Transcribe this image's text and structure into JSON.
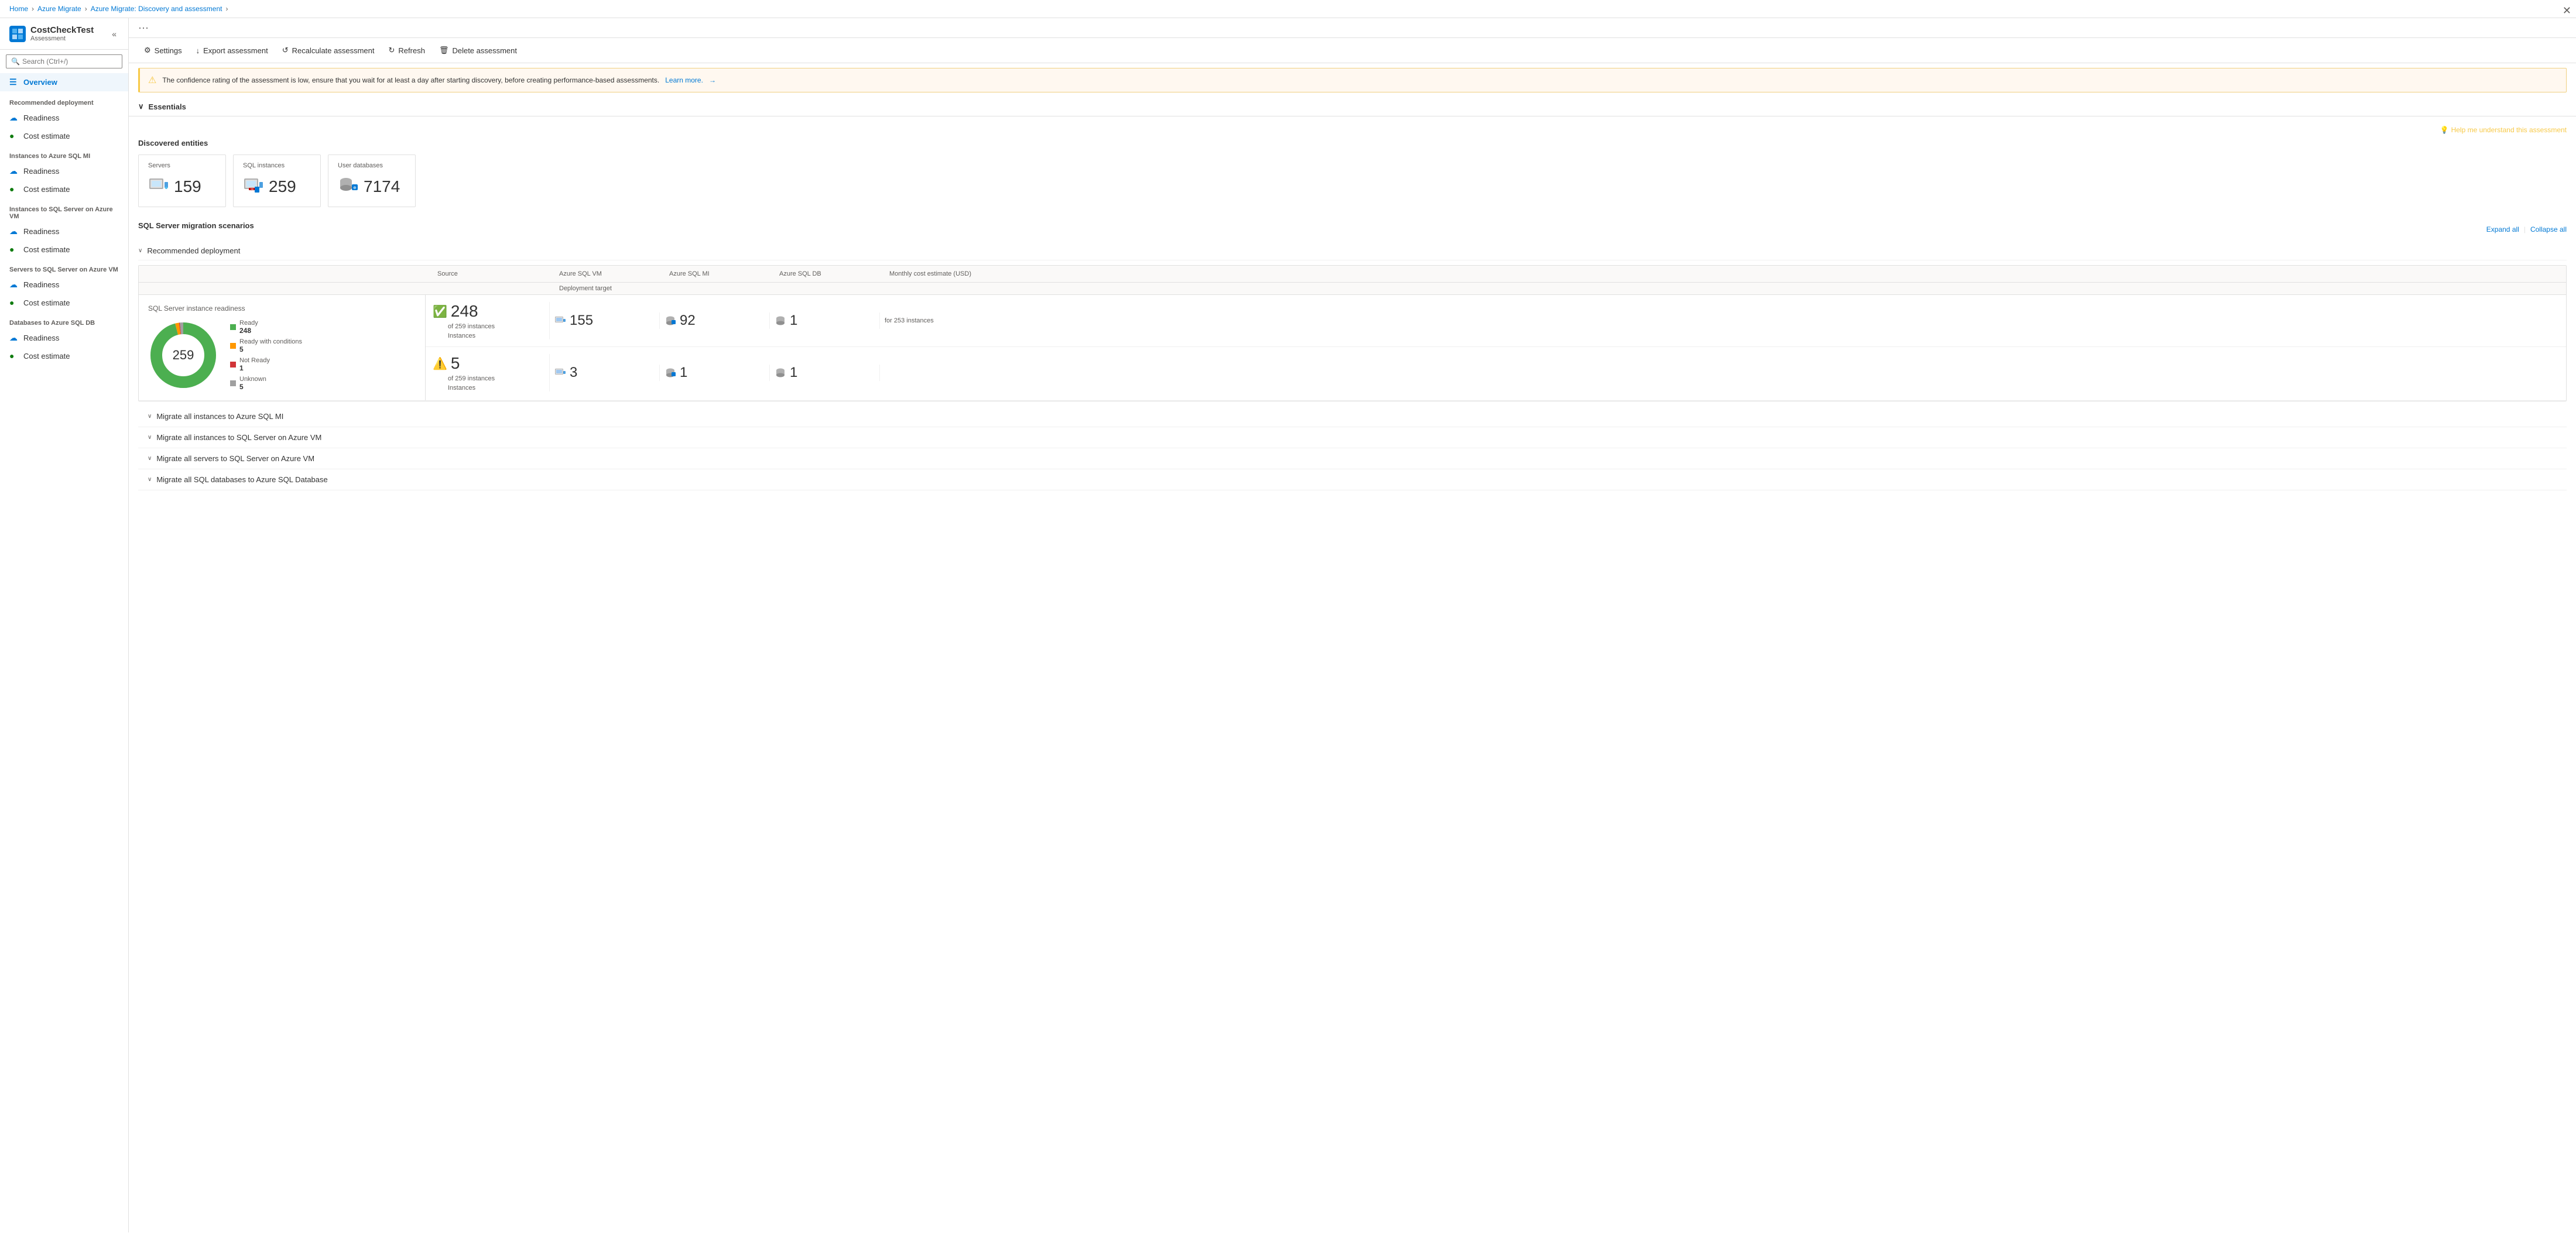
{
  "breadcrumb": {
    "home": "Home",
    "azure_migrate": "Azure Migrate",
    "discovery_assessment": "Azure Migrate: Discovery and assessment",
    "separator": "›"
  },
  "sidebar": {
    "app_icon": "🔷",
    "app_title": "CostCheckTest",
    "app_subtitle": "Assessment",
    "search_placeholder": "Search (Ctrl+/)",
    "nav_items": [
      {
        "id": "overview",
        "label": "Overview",
        "icon": "☰",
        "active": true,
        "section": null
      },
      {
        "id": "rec-deployment-header",
        "label": "Recommended deployment",
        "section": true
      },
      {
        "id": "readiness1",
        "label": "Readiness",
        "icon": "☁",
        "icon_color": "blue",
        "active": false,
        "section": null
      },
      {
        "id": "cost1",
        "label": "Cost estimate",
        "icon": "🟢",
        "icon_color": "green",
        "active": false,
        "section": null
      },
      {
        "id": "sql-mi-header",
        "label": "Instances to Azure SQL MI",
        "section": true
      },
      {
        "id": "readiness2",
        "label": "Readiness",
        "icon": "☁",
        "icon_color": "blue",
        "active": false,
        "section": null
      },
      {
        "id": "cost2",
        "label": "Cost estimate",
        "icon": "🟢",
        "icon_color": "green",
        "active": false,
        "section": null
      },
      {
        "id": "sql-vm-header",
        "label": "Instances to SQL Server on Azure VM",
        "section": true
      },
      {
        "id": "readiness3",
        "label": "Readiness",
        "icon": "☁",
        "icon_color": "blue",
        "active": false,
        "section": null
      },
      {
        "id": "cost3",
        "label": "Cost estimate",
        "icon": "🟢",
        "icon_color": "green",
        "active": false,
        "section": null
      },
      {
        "id": "servers-sql-vm-header",
        "label": "Servers to SQL Server on Azure VM",
        "section": true
      },
      {
        "id": "readiness4",
        "label": "Readiness",
        "icon": "☁",
        "icon_color": "blue",
        "active": false,
        "section": null
      },
      {
        "id": "cost4",
        "label": "Cost estimate",
        "icon": "🟢",
        "icon_color": "green",
        "active": false,
        "section": null
      },
      {
        "id": "db-sql-header",
        "label": "Databases to Azure SQL DB",
        "section": true
      },
      {
        "id": "readiness5",
        "label": "Readiness",
        "icon": "☁",
        "icon_color": "blue",
        "active": false,
        "section": null
      },
      {
        "id": "cost5",
        "label": "Cost estimate",
        "icon": "🟢",
        "icon_color": "green",
        "active": false,
        "section": null
      }
    ]
  },
  "toolbar": {
    "settings_label": "Settings",
    "export_label": "Export assessment",
    "recalculate_label": "Recalculate assessment",
    "refresh_label": "Refresh",
    "delete_label": "Delete assessment"
  },
  "warning": {
    "text": "The confidence rating of the assessment is low, ensure that you wait for at least a day after starting discovery, before creating performance-based assessments. Learn more.",
    "learn_more": "Learn more.",
    "arrow": "→"
  },
  "essentials": {
    "label": "Essentials",
    "chevron": "∨"
  },
  "help_link": "Help me understand this assessment",
  "discovered_entities": {
    "title": "Discovered entities",
    "servers": {
      "label": "Servers",
      "value": "159"
    },
    "sql_instances": {
      "label": "SQL instances",
      "value": "259"
    },
    "user_databases": {
      "label": "User databases",
      "value": "7174"
    }
  },
  "migration_scenarios": {
    "title": "SQL Server migration scenarios",
    "expand_all": "Expand all",
    "collapse_all": "Collapse all",
    "separator": "|",
    "recommended_deployment": {
      "label": "Recommended deployment",
      "expanded": true,
      "chart": {
        "title": "SQL Server instance readiness",
        "total": "259",
        "segments": [
          {
            "label": "Ready",
            "value": 248,
            "color": "#4caf50"
          },
          {
            "label": "Ready with conditions",
            "value": 5,
            "color": "#ff9800"
          },
          {
            "label": "Not Ready",
            "value": 1,
            "color": "#d13438"
          },
          {
            "label": "Unknown",
            "value": 5,
            "color": "#a0a0a0"
          }
        ]
      },
      "col_headers": {
        "source": "Source",
        "deployment_target": "Deployment target",
        "azure_sql_vm": "Azure SQL VM",
        "azure_sql_mi": "Azure SQL MI",
        "azure_sql_db": "Azure SQL DB",
        "monthly_cost": "Monthly cost estimate (USD)"
      },
      "rows": [
        {
          "status_icon": "✅",
          "status_color": "green",
          "instances": "248",
          "instances_sub": "of 259 instances",
          "vm_value": "155",
          "mi_value": "92",
          "db_value": "1",
          "cost_value": "",
          "cost_sub": "for 253 instances"
        },
        {
          "status_icon": "⚠️",
          "status_color": "orange",
          "instances": "5",
          "instances_sub": "of 259 instances",
          "vm_value": "3",
          "mi_value": "1",
          "db_value": "1",
          "cost_value": "",
          "cost_sub": ""
        }
      ]
    },
    "collapsed_items": [
      {
        "label": "Migrate all instances to Azure SQL MI"
      },
      {
        "label": "Migrate all instances to SQL Server on Azure VM"
      },
      {
        "label": "Migrate all servers to SQL Server on Azure VM"
      },
      {
        "label": "Migrate all SQL databases to Azure SQL Database"
      }
    ]
  },
  "close_button": "✕",
  "more_button": "···"
}
